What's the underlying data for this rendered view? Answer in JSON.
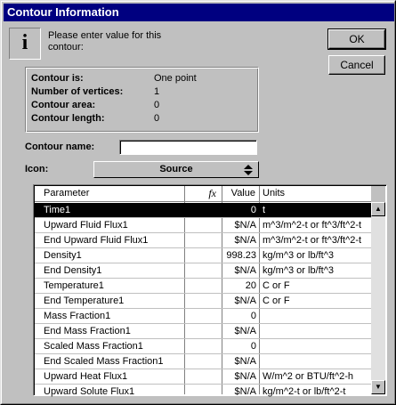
{
  "window": {
    "title": "Contour Information"
  },
  "icon": {
    "name": "info-icon",
    "glyph": "i"
  },
  "prompt": "Please enter value for this contour:",
  "buttons": {
    "ok": "OK",
    "cancel": "Cancel"
  },
  "contour_info": {
    "labels": [
      "Contour is:",
      "Number of vertices:",
      "Contour area:",
      "Contour length:"
    ],
    "values": [
      "One point",
      "1",
      "0",
      "0"
    ]
  },
  "contour_name": {
    "label": "Contour name:",
    "value": ""
  },
  "icon_select": {
    "label": "Icon:",
    "value": "Source"
  },
  "grid": {
    "headers": {
      "parameter": "Parameter",
      "fx": "fx",
      "value": "Value",
      "units": "Units"
    },
    "rows": [
      {
        "name": "Time1",
        "fx": "",
        "value": "0",
        "units": "t",
        "selected": true
      },
      {
        "name": "Upward Fluid Flux1",
        "fx": "",
        "value": "$N/A",
        "units": "m^3/m^2-t or ft^3/ft^2-t"
      },
      {
        "name": "End Upward Fluid Flux1",
        "fx": "",
        "value": "$N/A",
        "units": "m^3/m^2-t or ft^3/ft^2-t"
      },
      {
        "name": "Density1",
        "fx": "",
        "value": "998.23",
        "units": "kg/m^3 or lb/ft^3"
      },
      {
        "name": "End Density1",
        "fx": "",
        "value": "$N/A",
        "units": "kg/m^3 or lb/ft^3"
      },
      {
        "name": "Temperature1",
        "fx": "",
        "value": "20",
        "units": "C or F"
      },
      {
        "name": "End Temperature1",
        "fx": "",
        "value": "$N/A",
        "units": "C or F"
      },
      {
        "name": "Mass Fraction1",
        "fx": "",
        "value": "0",
        "units": ""
      },
      {
        "name": "End Mass Fraction1",
        "fx": "",
        "value": "$N/A",
        "units": ""
      },
      {
        "name": "Scaled Mass Fraction1",
        "fx": "",
        "value": "0",
        "units": ""
      },
      {
        "name": "End Scaled Mass Fraction1",
        "fx": "",
        "value": "$N/A",
        "units": ""
      },
      {
        "name": "Upward Heat Flux1",
        "fx": "",
        "value": "$N/A",
        "units": "W/m^2 or BTU/ft^2-h"
      },
      {
        "name": "Upward Solute Flux1",
        "fx": "",
        "value": "$N/A",
        "units": "kg/m^2-t or lb/ft^2-t"
      }
    ]
  },
  "colors": {
    "titlebar": "#000080",
    "selected_row": "#000000",
    "face": "#c0c0c0"
  }
}
